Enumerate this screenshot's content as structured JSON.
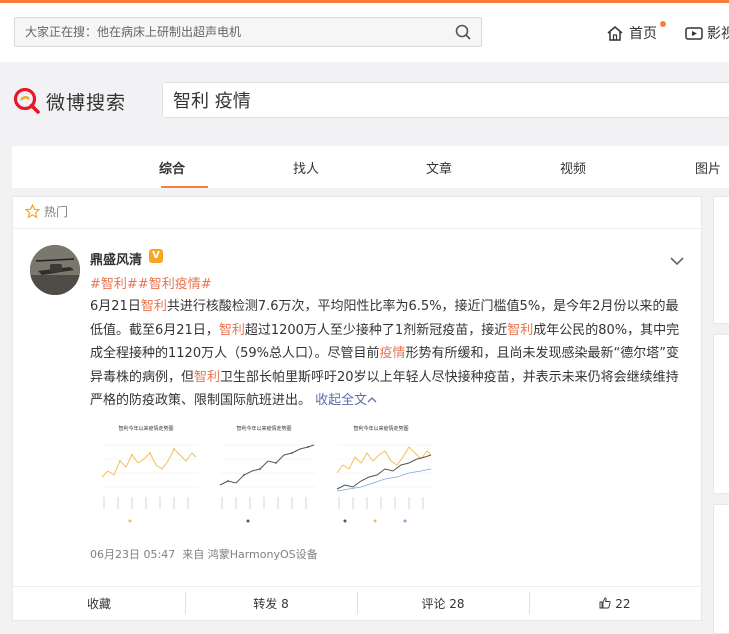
{
  "header": {
    "search_placeholder": "大家正在搜：他在病床上研制出超声电机",
    "home_label": "首页",
    "video_label": "影视"
  },
  "logo": {
    "text": "微博搜索"
  },
  "search": {
    "query": "智利 疫情"
  },
  "tabs": [
    "综合",
    "找人",
    "文章",
    "视频",
    "图片"
  ],
  "active_tab": "综合",
  "card": {
    "hot_label": "热门",
    "user": "鼎盛风清",
    "tags": [
      "#智利#",
      "#智利疫情#"
    ],
    "body": [
      {
        "t": "6月21日"
      },
      {
        "t": "智利",
        "hl": true
      },
      {
        "t": "共进行核酸检测7.6万次，平均阳性比率为6.5%，接近门槛值5%，是今年2月份以来的最低值。截至6月21日，"
      },
      {
        "t": "智利",
        "hl": true
      },
      {
        "t": "超过1200万人至少接种了1剂新冠疫苗，接近"
      },
      {
        "t": "智利",
        "hl": true
      },
      {
        "t": "成年公民的80%，其中完成全程接种的1120万人（59%总人口）。尽管目前"
      },
      {
        "t": "疫情",
        "hl": true
      },
      {
        "t": "形势有所缓和，且尚未发现感染最新“德尔塔”变异毒株的病例，但"
      },
      {
        "t": "智利",
        "hl": true
      },
      {
        "t": "卫生部长帕里斯呼吁20岁以上年轻人尽快接种疫苗，并表示未来仍将会继续维持严格的防疫政策、限制国际航班进出。"
      }
    ],
    "more_label": "收起全文",
    "thumbs": [
      {
        "title": "智利今年以来疫情走势图"
      },
      {
        "title": "智利今年以来疫情走势图"
      },
      {
        "title": "智利今年以来疫情走势图"
      }
    ],
    "time": "06月23日 05:47",
    "source_prefix": "来自",
    "source": "鸿蒙HarmonyOS设备",
    "actions": {
      "collect": "收藏",
      "repost": "转发 8",
      "comment": "评论 28",
      "like": "22"
    }
  },
  "colors": {
    "accent": "#fa7d3c",
    "highlight": "#eb7350",
    "link": "#5b6ea8"
  }
}
